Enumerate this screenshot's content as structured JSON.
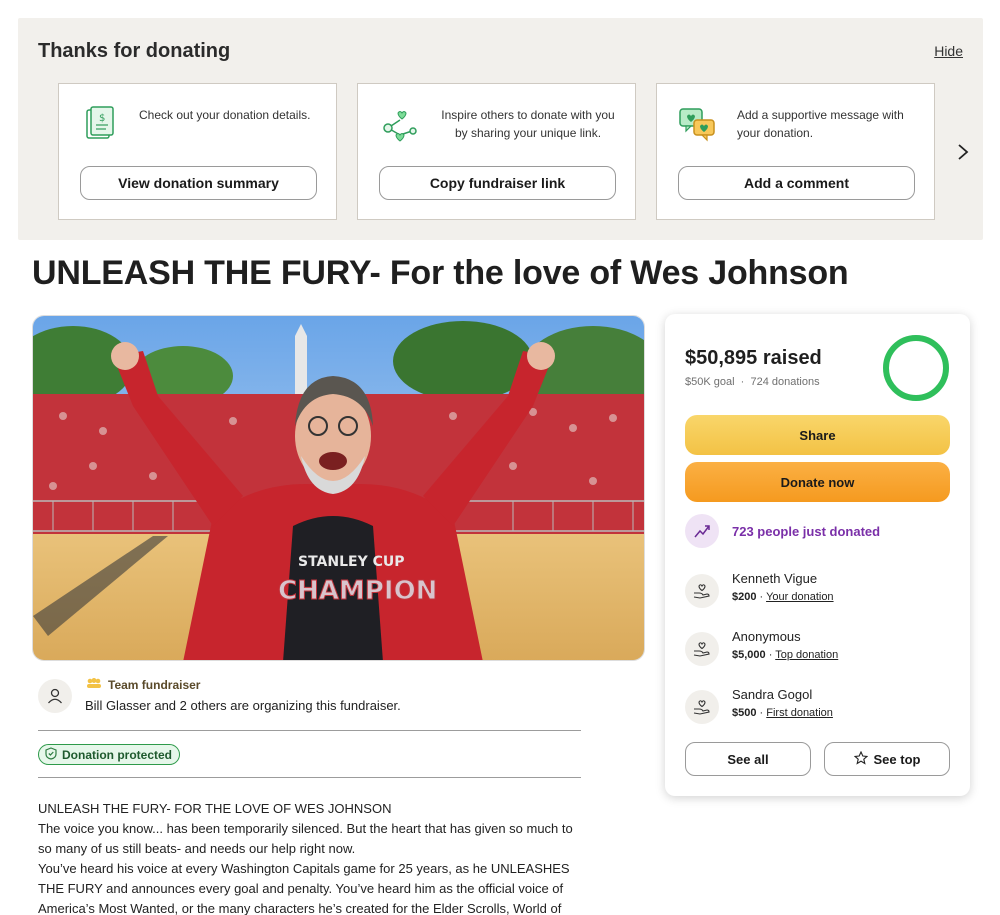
{
  "thanks": {
    "title": "Thanks for donating",
    "hide_label": "Hide",
    "cards": [
      {
        "icon": "receipt-icon",
        "text": "Check out your donation details.",
        "button": "View donation summary"
      },
      {
        "icon": "share-icon",
        "text": "Inspire others to donate with you by sharing your unique link.",
        "button": "Copy fundraiser link"
      },
      {
        "icon": "comment-hearts-icon",
        "text": "Add a supportive message with your donation.",
        "button": "Add a comment"
      }
    ],
    "next_icon": "chevron-right-icon"
  },
  "fundraiser": {
    "title": "UNLEASH THE FURY- For the love of Wes Johnson",
    "hero_alt": "Man in red jacket cheering in front of crowd",
    "team_label": "Team fundraiser",
    "organizer_text": "Bill Glasser and 2 others are organizing this fundraiser.",
    "protected_label": "Donation protected",
    "story": [
      "UNLEASH THE FURY- FOR THE LOVE OF WES JOHNSON",
      "The voice you know... has been temporarily silenced. But the heart that has given so much to so many of us still beats- and needs our help right now.",
      "You’ve heard his voice at every Washington Capitals game for 25 years, as he UNLEASHES THE FURY and announces every goal and penalty. You’ve heard him as the official voice of America’s Most Wanted, or the many characters he’s created for the Elder Scrolls, World of"
    ]
  },
  "panel": {
    "raised": "$50,895 raised",
    "goal": "$50K goal",
    "donations": "724 donations",
    "progress_fraction": 1.0,
    "share_label": "Share",
    "donate_label": "Donate now",
    "recent_text": "723 people just donated",
    "donors": [
      {
        "name": "Kenneth Vigue",
        "amount": "$200",
        "tag": "Your donation"
      },
      {
        "name": "Anonymous",
        "amount": "$5,000",
        "tag": "Top donation"
      },
      {
        "name": "Sandra Gogol",
        "amount": "$500",
        "tag": "First donation"
      }
    ],
    "see_all_label": "See all",
    "see_top_label": "See top"
  },
  "colors": {
    "accent_green": "#2fbf5b",
    "share_yellow": "#f5c84f",
    "donate_orange": "#f7a22e",
    "trend_purple": "#7a2fa8"
  }
}
